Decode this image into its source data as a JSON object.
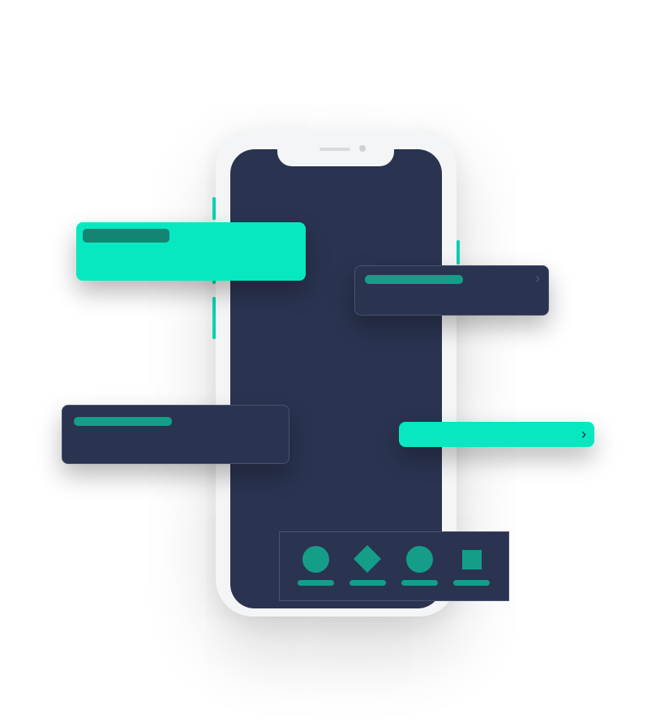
{
  "colors": {
    "background": "#ffffff",
    "phone_body": "#f4f5f6",
    "screen": "#2a3350",
    "card_dark": "#2a3350",
    "accent": "#07e8c1",
    "accent_bar_on_light": "#138573",
    "accent_muted": "#149e8a",
    "chevron_light": "#4f5a76",
    "chevron_dark": "#1d2540"
  },
  "icons": {
    "card_b_chevron": "chevron-right-icon",
    "card_d_chevron": "chevron-right-icon",
    "tab_1": "circle-icon",
    "tab_2": "diamond-icon",
    "tab_3": "circle-icon",
    "tab_4": "square-icon"
  },
  "glyphs": {
    "chevron": "›"
  }
}
